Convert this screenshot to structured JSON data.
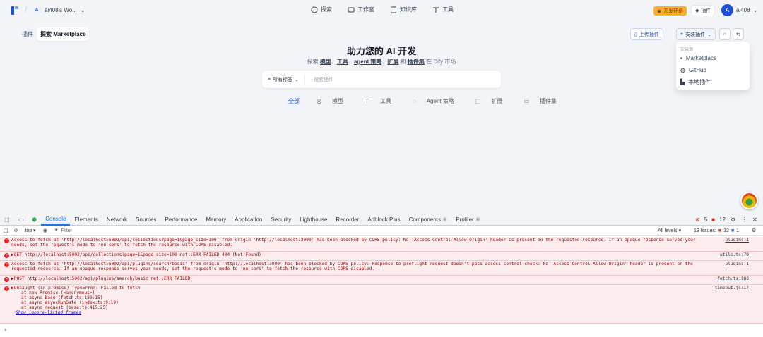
{
  "app": {
    "workspace": "ai408's Wo...",
    "workspace_initial": "A",
    "nav": [
      {
        "label": "探索",
        "icon": "compass-icon"
      },
      {
        "label": "工作室",
        "icon": "studio-icon"
      },
      {
        "label": "知识库",
        "icon": "book-icon"
      },
      {
        "label": "工具",
        "icon": "tool-icon"
      }
    ],
    "env_badge": "开发环境",
    "plugin_button": "插件",
    "user_initial": "A",
    "user_name": "ai408"
  },
  "tabs": [
    "插件",
    "探索 Marketplace"
  ],
  "actions": {
    "upload": "上传插件",
    "install": "安装插件"
  },
  "hero": {
    "title": "助力您的 AI 开发",
    "sub_prefix": "探索",
    "sub_model": "模型",
    "sub_sep1": "、",
    "sub_tool": "工具",
    "sub_sep2": "、",
    "sub_agent": "agent 策略",
    "sub_sep3": "、",
    "sub_ext": "扩展",
    "sub_and": "和",
    "sub_bundle": "插件集",
    "sub_suffix": "在 Dify 市场"
  },
  "search": {
    "tag": "所有标签",
    "placeholder": "搜索插件"
  },
  "categories": [
    "全部",
    "模型",
    "工具",
    "Agent 策略",
    "扩展",
    "插件集"
  ],
  "dropdown": {
    "header": "安装源",
    "items": [
      "Marketplace",
      "GitHub",
      "本地插件"
    ]
  },
  "devtools": {
    "tabs": [
      "Elements",
      "Console",
      "Network",
      "Sources",
      "Performance",
      "Memory",
      "Application",
      "Security",
      "Lighthouse",
      "Recorder",
      "Adblock Plus",
      "Components ⚛",
      "Profiler ⚛"
    ],
    "errors": "5",
    "warnings": "12",
    "context": "top",
    "filter": "Filter",
    "levels": "All levels ▾",
    "issues_label": "13 Issues:",
    "issues_err": "12",
    "issues_info": "1"
  },
  "logs": [
    {
      "l1": "Access to fetch at 'http://localhost:5002/api/collections?page=1&page_size=100' from origin 'http://localhost:3000' has been blocked by CORS policy: No 'Access-Control-Allow-Origin' header is present on the requested resource. If an opaque response serves your",
      "l2": "needs, set the request's mode to 'no-cors' to fetch the resource with CORS disabled.",
      "src": "plugins:1"
    },
    {
      "l1": "▶GET http://localhost:5002/api/collections?page=1&page_size=100 net::ERR_FAILED 404 (Not Found)",
      "src": "utils.ts:79"
    },
    {
      "l1": "Access to fetch at 'http://localhost:5002/api/plugins/search/basic' from origin 'http://localhost:3000' has been blocked by CORS policy: Response to preflight request doesn't pass access control check: No 'Access-Control-Allow-Origin' header is present on the",
      "l2": "requested resource. If an opaque response serves your needs, set the request's mode to 'no-cors' to fetch the resource with CORS disabled.",
      "src": "plugins:1"
    },
    {
      "l1": "▶POST http://localhost:5002/api/plugins/search/basic net::ERR_FAILED",
      "src": "fetch.ts:180"
    },
    {
      "l1": "▶Uncaught (in promise) TypeError: Failed to fetch",
      "l2": "at new Promise (<anonymous>)",
      "l3": "at async base (fetch.ts:180:15)",
      "l4": "at async asyncRunSafe (index.ts:9:19)",
      "l5": "at async request (base.ts:415:25)",
      "l6": "Show ignore-listed frames",
      "src": "timeout.js:17"
    }
  ]
}
